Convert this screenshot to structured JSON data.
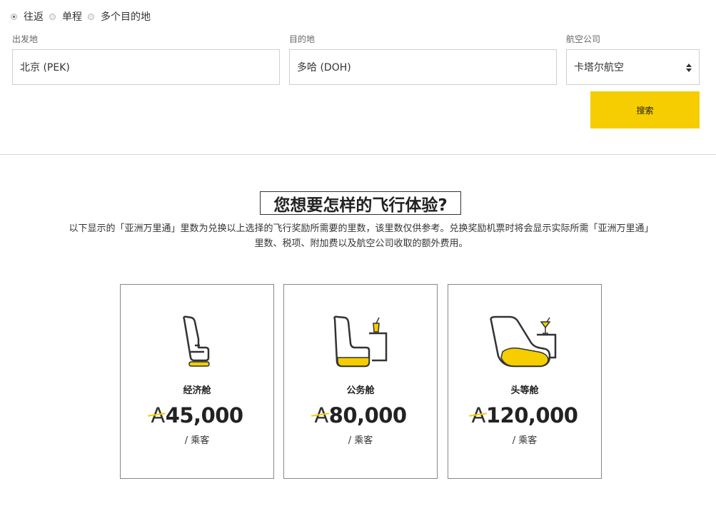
{
  "trip_types": {
    "options": [
      {
        "label": "往返",
        "checked": true
      },
      {
        "label": "单程",
        "checked": false
      },
      {
        "label": "多个目的地",
        "checked": false
      }
    ]
  },
  "form": {
    "origin": {
      "label": "出发地",
      "value": "北京 (PEK)"
    },
    "destination": {
      "label": "目的地",
      "value": "多哈 (DOH)"
    },
    "airline": {
      "label": "航空公司",
      "value": "卡塔尔航空"
    },
    "search_label": "搜索"
  },
  "section": {
    "title": "您想要怎样的飞行体验?",
    "description": "以下显示的「亚洲万里通」里数为兑换以上选择的飞行奖励所需要的里数，该里数仅供参考。兑换奖励机票时将会显示实际所需「亚洲万里通」里数、税项、附加费以及航空公司收取的额外费用。"
  },
  "cards": [
    {
      "name": "经济舱",
      "currency_symbol": "A",
      "price": "45,000",
      "per": "/ 乘客",
      "icon": "economy-seat-icon"
    },
    {
      "name": "公务舱",
      "currency_symbol": "A",
      "price": "80,000",
      "per": "/ 乘客",
      "icon": "business-seat-icon"
    },
    {
      "name": "头等舱",
      "currency_symbol": "A",
      "price": "120,000",
      "per": "/ 乘客",
      "icon": "first-class-seat-icon"
    }
  ],
  "colors": {
    "accent": "#f5cd00",
    "text": "#333333",
    "border": "#cfcfcf"
  }
}
